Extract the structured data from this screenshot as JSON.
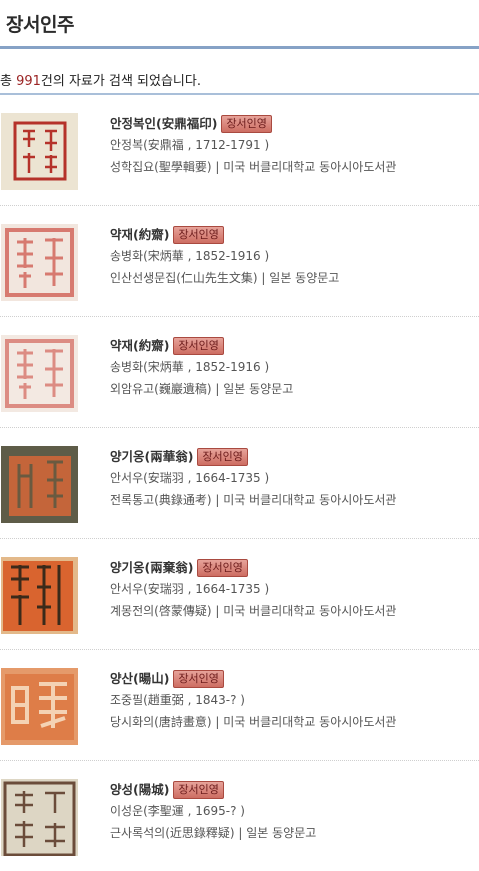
{
  "page": {
    "title": "장서인주"
  },
  "summary": {
    "prefix": "총 ",
    "count": "991",
    "suffix": "건의 자료가 검색 되었습니다."
  },
  "badge_label": "장서인영",
  "items": [
    {
      "seal_name": "안정복인(安鼎福印)",
      "person": "안정복(安鼎福 , 1712-1791 )",
      "book_title": "성학집요(聖學輯要)",
      "library": " | 미국 버클리대학교 동아시아도서관"
    },
    {
      "seal_name": "약재(約齋)",
      "person": "송병화(宋炳華 , 1852-1916 )",
      "book_title": "인산선생문집(仁山先生文集)",
      "library": " | 일본 동양문고"
    },
    {
      "seal_name": "약재(約齋)",
      "person": "송병화(宋炳華 , 1852-1916 )",
      "book_title": "외암유고(巍巖遺稿)",
      "library": " | 일본 동양문고"
    },
    {
      "seal_name": "양기옹(兩華翁)",
      "person": "안서우(安瑞羽 , 1664-1735 )",
      "book_title": "전록통고(典錄通考)",
      "library": " | 미국 버클리대학교 동아시아도서관"
    },
    {
      "seal_name": "양기옹(兩棄翁)",
      "person": "안서우(安瑞羽 , 1664-1735 )",
      "book_title": "계몽전의(啓蒙傳疑)",
      "library": " | 미국 버클리대학교 동아시아도서관"
    },
    {
      "seal_name": "양산(暘山)",
      "person": "조중필(趙重弼 , 1843-? )",
      "book_title": "당시화의(唐詩畫意)",
      "library": " | 미국 버클리대학교 동아시아도서관"
    },
    {
      "seal_name": "양성(陽城)",
      "person": "이성운(李聖運 , 1695-? )",
      "book_title": "근사록석의(近思錄釋疑)",
      "library": " | 일본 동양문고"
    }
  ],
  "colors": {
    "header_rule": "#86a2c6",
    "count": "#9b2424",
    "badge_bg": "#d98a80",
    "seal_red": "#c0392b"
  }
}
